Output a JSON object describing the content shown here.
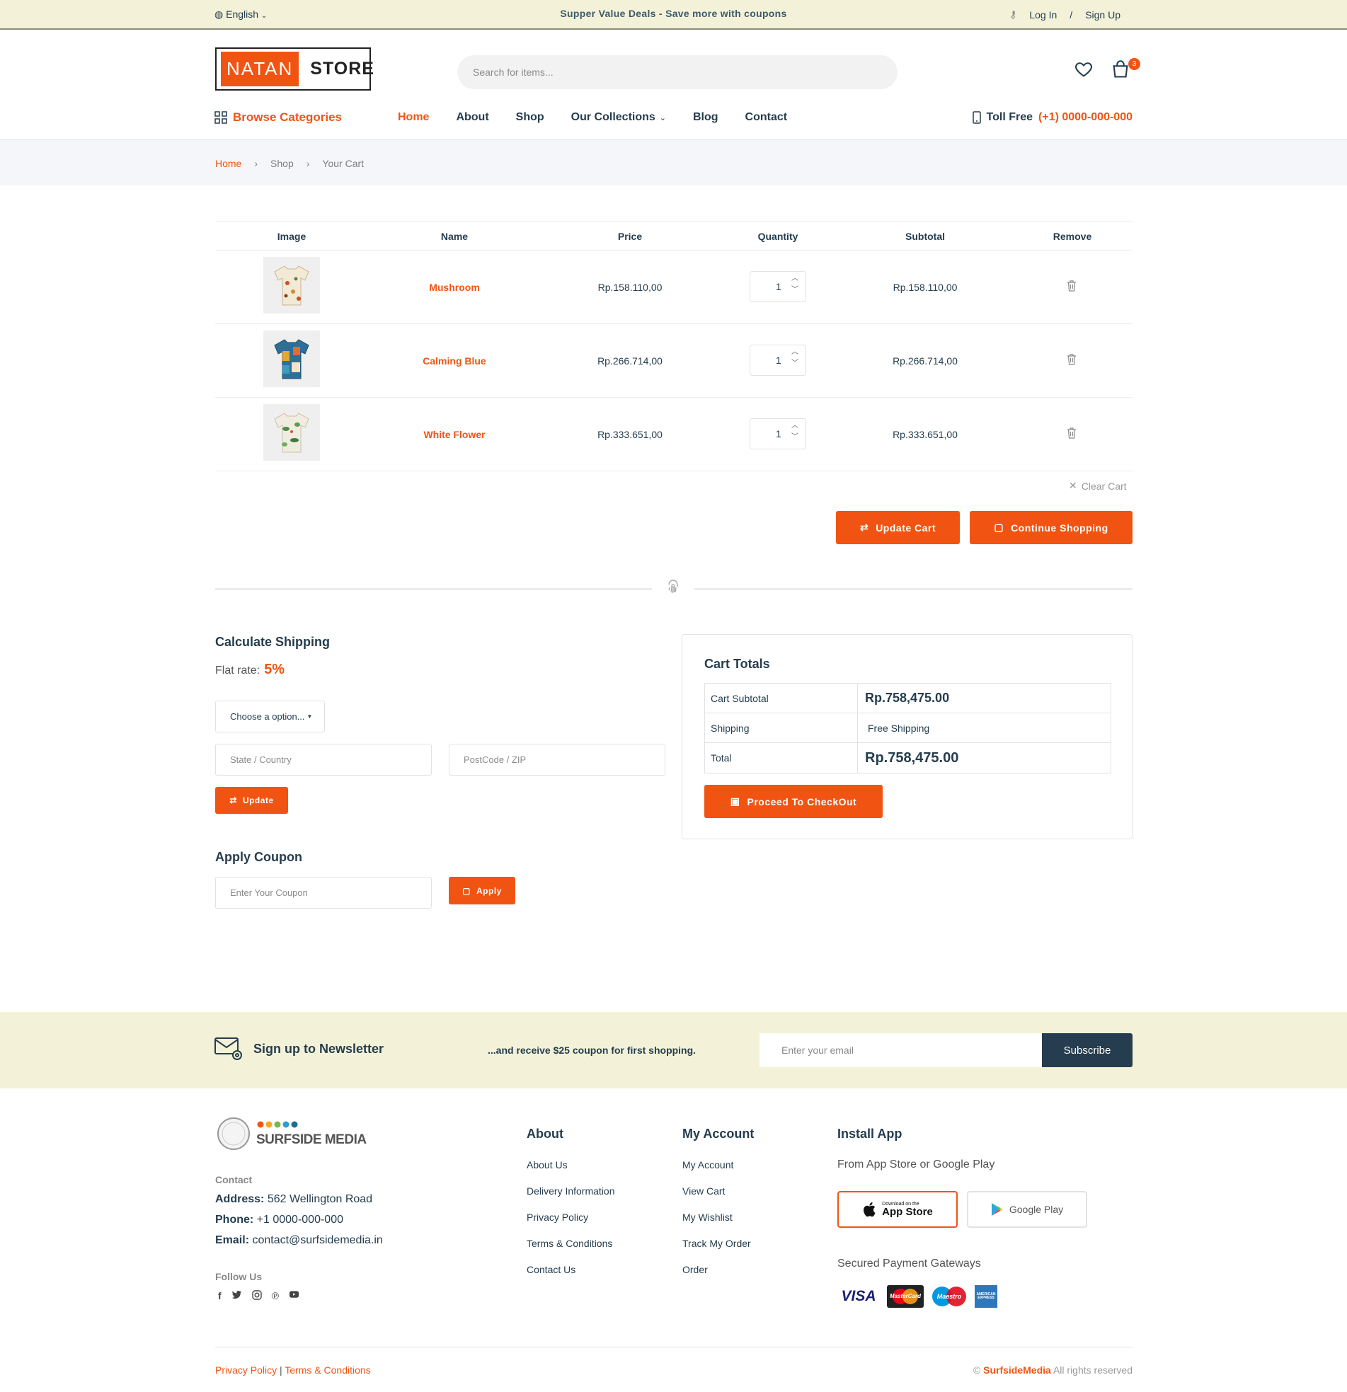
{
  "topbar": {
    "language": "English",
    "promo": "Supper Value Deals - Save more with coupons",
    "login": "Log In",
    "separator": "/",
    "signup": "Sign Up"
  },
  "header": {
    "logo_left": "NATAN",
    "logo_right": "STORE",
    "search_placeholder": "Search for items...",
    "cart_count": "3"
  },
  "nav": {
    "browse": "Browse Categories",
    "items": [
      "Home",
      "About",
      "Shop",
      "Our Collections",
      "Blog",
      "Contact"
    ],
    "toll_label": "Toll Free",
    "toll_number": "(+1) 0000-000-000"
  },
  "breadcrumb": [
    "Home",
    "Shop",
    "Your Cart"
  ],
  "cart": {
    "headers": [
      "Image",
      "Name",
      "Price",
      "Quantity",
      "Subtotal",
      "Remove"
    ],
    "rows": [
      {
        "name": "Mushroom",
        "price": "Rp.158.110,00",
        "qty": "1",
        "subtotal": "Rp.158.110,00"
      },
      {
        "name": "Calming Blue",
        "price": "Rp.266.714,00",
        "qty": "1",
        "subtotal": "Rp.266.714,00"
      },
      {
        "name": "White Flower",
        "price": "Rp.333.651,00",
        "qty": "1",
        "subtotal": "Rp.333.651,00"
      }
    ],
    "clear": "Clear Cart",
    "update": "Update Cart",
    "continue": "Continue Shopping"
  },
  "shipping": {
    "title": "Calculate Shipping",
    "flat_label": "Flat rate:",
    "flat_value": "5%",
    "select": "Choose a option...",
    "state_placeholder": "State / Country",
    "zip_placeholder": "PostCode / ZIP",
    "update": "Update"
  },
  "coupon": {
    "title": "Apply Coupon",
    "placeholder": "Enter Your Coupon",
    "apply": "Apply"
  },
  "totals": {
    "title": "Cart Totals",
    "subtotal_label": "Cart Subtotal",
    "subtotal_value": "Rp.758,475.00",
    "shipping_label": "Shipping",
    "shipping_value": "Free Shipping",
    "total_label": "Total",
    "total_value": "Rp.758,475.00",
    "checkout": "Proceed To CheckOut"
  },
  "newsletter": {
    "title": "Sign up to Newsletter",
    "text": "...and receive $25 coupon for first shopping.",
    "placeholder": "Enter your email",
    "button": "Subscribe"
  },
  "footer": {
    "brand": "SURFSIDE MEDIA",
    "contact_title": "Contact",
    "address_label": "Address:",
    "address": "562 Wellington Road",
    "phone_label": "Phone:",
    "phone": "+1 0000-000-000",
    "email_label": "Email:",
    "email": "contact@surfsidemedia.in",
    "follow": "Follow Us",
    "about_title": "About",
    "about_links": [
      "About Us",
      "Delivery Information",
      "Privacy Policy",
      "Terms & Conditions",
      "Contact Us"
    ],
    "account_title": "My Account",
    "account_links": [
      "My Account",
      "View Cart",
      "My Wishlist",
      "Track My Order",
      "Order"
    ],
    "app_title": "Install App",
    "app_sub": "From App Store or Google Play",
    "appstore_small": "Download on the",
    "appstore": "App Store",
    "googleplay": "Google Play",
    "payments_title": "Secured Payment Gateways",
    "payments": [
      "VISA",
      "MasterCard",
      "Maestro",
      "AMERICAN EXPRESS"
    ],
    "privacy": "Privacy Policy",
    "sep": "|",
    "terms": "Terms & Conditions",
    "copy_symbol": "©",
    "copy_brand": "SurfsideMedia",
    "copy_text": "All rights reserved"
  },
  "colors": {
    "accent": "#f15412",
    "topbar": "#f3f2d8",
    "dark": "#253D4E"
  }
}
